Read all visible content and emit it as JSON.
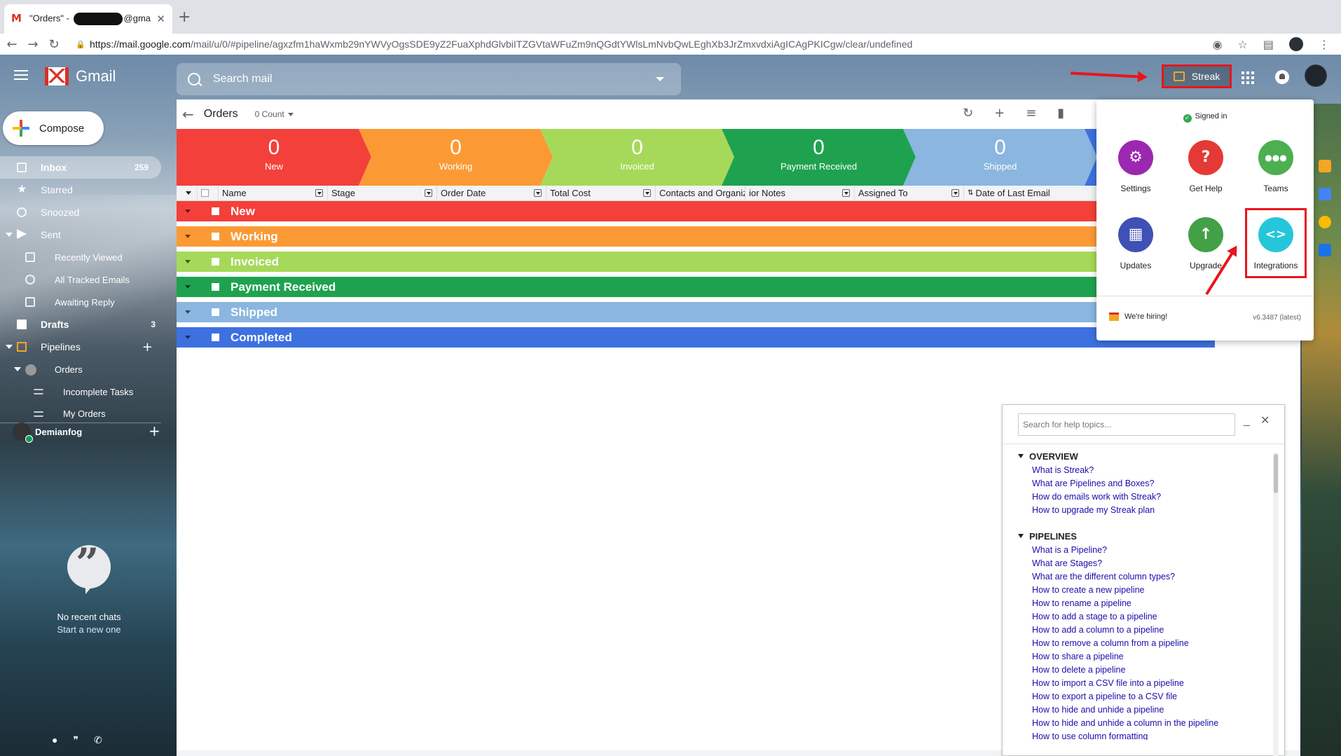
{
  "browser": {
    "tab_title_prefix": "\"Orders\" - ",
    "tab_title_suffix": "@gmail.c",
    "url_host": "https://mail.google.com",
    "url_path": "/mail/u/0/#pipeline/agxzfm1haWxmb29nYWVyOgsSDE9yZ2FuaXphdGlvbiITZGVtaWFuZm9nQGdtYWlsLmNvbQwLEghXb3JrZmxvdxiAgICAgPKICgw/clear/undefined"
  },
  "gmail": {
    "brand": "Gmail",
    "search_placeholder": "Search mail",
    "streak_label": "Streak",
    "compose_label": "Compose"
  },
  "sidebar": {
    "items": [
      {
        "label": "Inbox",
        "count": "259"
      },
      {
        "label": "Starred"
      },
      {
        "label": "Snoozed"
      },
      {
        "label": "Sent"
      },
      {
        "label": "Recently Viewed"
      },
      {
        "label": "All Tracked Emails"
      },
      {
        "label": "Awaiting Reply"
      },
      {
        "label": "Drafts",
        "count": "3"
      },
      {
        "label": "Pipelines"
      },
      {
        "label": "Orders"
      },
      {
        "label": "Incomplete Tasks"
      },
      {
        "label": "My Orders"
      }
    ],
    "user": "Demianfog",
    "no_chats": "No recent chats",
    "start_new": "Start a new one"
  },
  "pipeline": {
    "title": "Orders",
    "count_label": "0 Count",
    "stages": [
      {
        "count": "0",
        "name": "New",
        "color": "#f4403a"
      },
      {
        "count": "0",
        "name": "Working",
        "color": "#fb9a35"
      },
      {
        "count": "0",
        "name": "Invoiced",
        "color": "#a6d959"
      },
      {
        "count": "0",
        "name": "Payment Received",
        "color": "#1fa24f"
      },
      {
        "count": "0",
        "name": "Shipped",
        "color": "#8ab6e0"
      }
    ],
    "columns": [
      "Name",
      "Stage",
      "Order Date",
      "Total Cost",
      "Contacts and Organiz",
      "ior Notes",
      "Assigned To",
      "Date of Last Email"
    ],
    "groups": [
      {
        "label": "New",
        "color": "#f4403a"
      },
      {
        "label": "Working",
        "color": "#fb9a35"
      },
      {
        "label": "Invoiced",
        "color": "#a6d959"
      },
      {
        "label": "Payment Received",
        "color": "#1fa24f"
      },
      {
        "label": "Shipped",
        "color": "#8ab6e0"
      },
      {
        "label": "Completed",
        "color": "#3d71e0"
      }
    ]
  },
  "streak_menu": {
    "signed_in": "Signed in",
    "buttons": [
      {
        "label": "Settings",
        "icon": "gear-icon",
        "color": "#9c27b0",
        "glyph": "⚙"
      },
      {
        "label": "Get Help",
        "icon": "question-icon",
        "color": "#e53935",
        "glyph": "?"
      },
      {
        "label": "Teams",
        "icon": "group-icon",
        "color": "#4caf50",
        "glyph": "●●●"
      },
      {
        "label": "Updates",
        "icon": "calendar-icon",
        "color": "#3f51b5",
        "glyph": "▦"
      },
      {
        "label": "Upgrade",
        "icon": "arrow-up-icon",
        "color": "#43a047",
        "glyph": "↑"
      },
      {
        "label": "Integrations",
        "icon": "code-icon",
        "color": "#26c6da",
        "glyph": "<>"
      }
    ],
    "hiring": "We're hiring!",
    "version": "v6.3487 (latest)"
  },
  "help": {
    "search_placeholder": "Search for help topics...",
    "sections": [
      {
        "title": "OVERVIEW",
        "links": [
          "What is Streak?",
          "What are Pipelines and Boxes?",
          "How do emails work with Streak?",
          "How to upgrade my Streak plan"
        ]
      },
      {
        "title": "PIPELINES",
        "links": [
          "What is a Pipeline?",
          "What are Stages?",
          "What are the different column types?",
          "How to create a new pipeline",
          "How to rename a pipeline",
          "How to add a stage to a pipeline",
          "How to add a column to a pipeline",
          "How to remove a column from a pipeline",
          "How to share a pipeline",
          "How to delete a pipeline",
          "How to import a CSV file into a pipeline",
          "How to export a pipeline to a CSV file",
          "How to hide and unhide a pipeline",
          "How to hide and unhide a column in the pipeline",
          "How to use column formatting"
        ]
      }
    ]
  }
}
